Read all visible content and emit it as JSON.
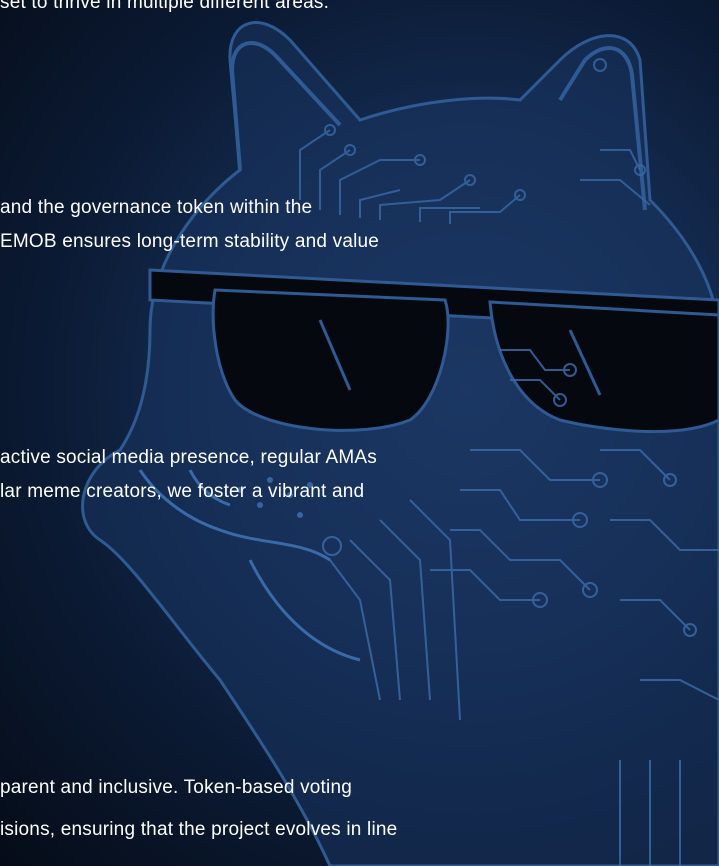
{
  "paragraphs": {
    "p1": {
      "line1": "set to thrive in multiple different areas."
    },
    "p2": {
      "line1": " and the governance token within the",
      "line2": "EMOB ensures long-term stability and value"
    },
    "p3": {
      "line1": "active social media presence, regular AMAs",
      "line2": "lar meme creators, we foster a vibrant and"
    },
    "p4": {
      "line1": "parent and inclusive. Token-based voting",
      "line2": "isions, ensuring that the project evolves in line"
    }
  },
  "colors": {
    "background": "#142c52",
    "circuit": "#2f5a93",
    "glasses": "#05080f",
    "text": "#ffffff"
  },
  "icons": {
    "background_art": "circuit-doge-with-sunglasses"
  }
}
